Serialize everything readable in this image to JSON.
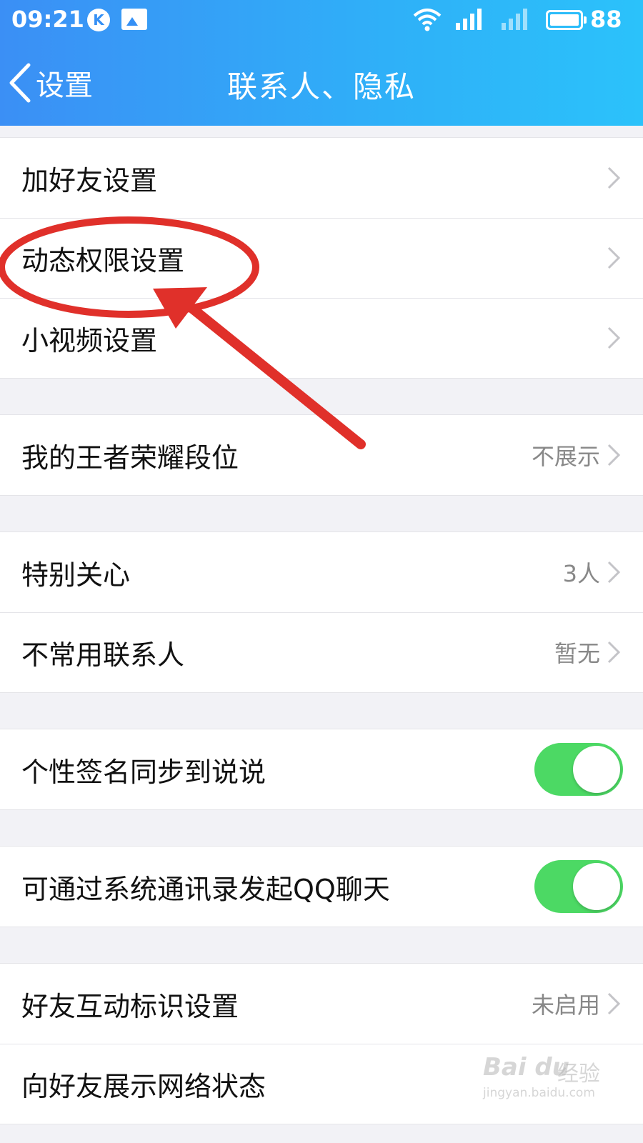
{
  "status_bar": {
    "time": "09:21",
    "k_badge": "K",
    "battery_level": "88"
  },
  "nav": {
    "back_label": "设置",
    "title": "联系人、隐私"
  },
  "groups": [
    {
      "rows": [
        {
          "label": "加好友设置",
          "value": "",
          "control": "chevron"
        },
        {
          "label": "动态权限设置",
          "value": "",
          "control": "chevron"
        },
        {
          "label": "小视频设置",
          "value": "",
          "control": "chevron"
        }
      ]
    },
    {
      "rows": [
        {
          "label": "我的王者荣耀段位",
          "value": "不展示",
          "control": "chevron"
        }
      ]
    },
    {
      "rows": [
        {
          "label": "特别关心",
          "value": "3人",
          "control": "chevron"
        },
        {
          "label": "不常用联系人",
          "value": "暂无",
          "control": "chevron"
        }
      ]
    },
    {
      "rows": [
        {
          "label": "个性签名同步到说说",
          "control": "toggle",
          "on": true
        }
      ]
    },
    {
      "rows": [
        {
          "label": "可通过系统通讯录发起QQ聊天",
          "control": "toggle",
          "on": true
        }
      ]
    },
    {
      "rows": [
        {
          "label": "好友互动标识设置",
          "value": "未启用",
          "control": "chevron"
        },
        {
          "label": "向好友展示网络状态",
          "value": "",
          "control": "none"
        }
      ]
    }
  ],
  "colors": {
    "header_start": "#3b8ff5",
    "header_end": "#2bc2fa",
    "toggle_on": "#4cd964",
    "annotation_red": "#e0302a"
  },
  "watermark": {
    "brand": "Bai du",
    "cn": "经验",
    "url": "jingyan.baidu.com"
  }
}
